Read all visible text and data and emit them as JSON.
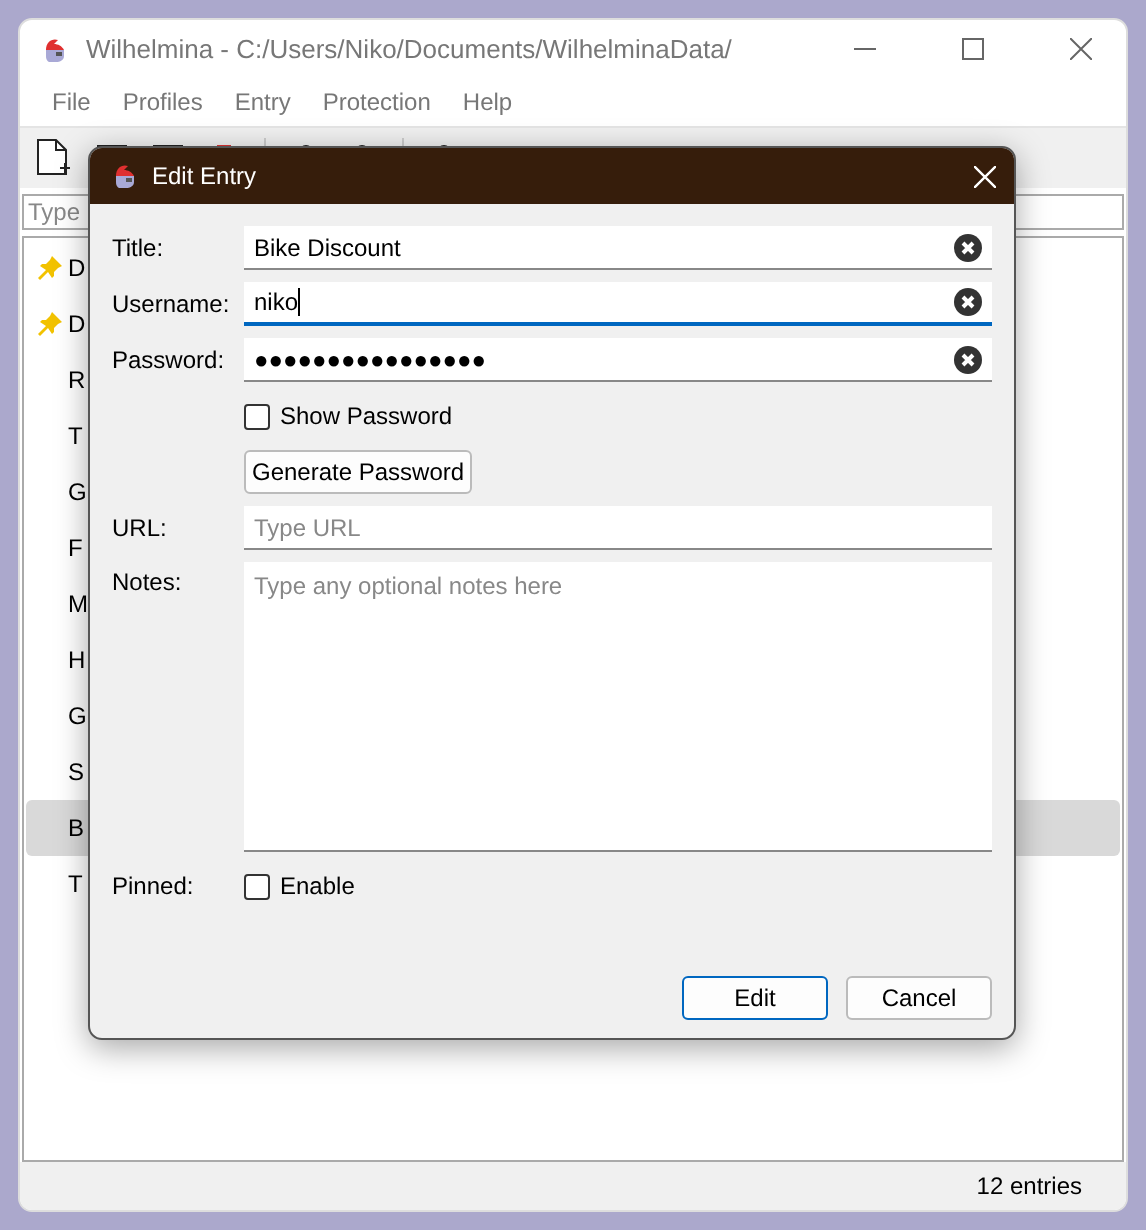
{
  "window": {
    "title": "Wilhelmina - C:/Users/Niko/Documents/WilhelminaData/"
  },
  "menu": [
    "File",
    "Profiles",
    "Entry",
    "Protection",
    "Help"
  ],
  "search": {
    "placeholder": "Type"
  },
  "entries": [
    {
      "label": "D",
      "pinned": true,
      "selected": false
    },
    {
      "label": "D",
      "pinned": true,
      "selected": false
    },
    {
      "label": "R",
      "pinned": false,
      "selected": false
    },
    {
      "label": "T",
      "pinned": false,
      "selected": false
    },
    {
      "label": "G",
      "pinned": false,
      "selected": false
    },
    {
      "label": "F",
      "pinned": false,
      "selected": false
    },
    {
      "label": "M",
      "pinned": false,
      "selected": false
    },
    {
      "label": "H",
      "pinned": false,
      "selected": false
    },
    {
      "label": "G",
      "pinned": false,
      "selected": false
    },
    {
      "label": "S",
      "pinned": false,
      "selected": false
    },
    {
      "label": "B",
      "pinned": false,
      "selected": true
    },
    {
      "label": "T",
      "pinned": false,
      "selected": false
    }
  ],
  "status_bar": "12 entries",
  "dialog": {
    "title": "Edit Entry",
    "fields": [
      {
        "label": "Title:",
        "value": "Bike Discount",
        "focused": false
      },
      {
        "label": "Username:",
        "value": "niko",
        "focused": true
      },
      {
        "label": "Password:",
        "value": "●●●●●●●●●●●●●●●●",
        "focused": false
      }
    ],
    "show_password": {
      "label": "Show Password",
      "checked": false
    },
    "generate_button": "Generate Password",
    "url": {
      "label": "URL:",
      "placeholder": "Type URL"
    },
    "notes": {
      "label": "Notes:",
      "placeholder": "Type any optional notes here"
    },
    "pinned": {
      "label": "Pinned:",
      "option": "Enable",
      "checked": false
    },
    "buttons": [
      {
        "label": "Edit",
        "default": true
      },
      {
        "label": "Cancel",
        "default": false
      }
    ]
  }
}
